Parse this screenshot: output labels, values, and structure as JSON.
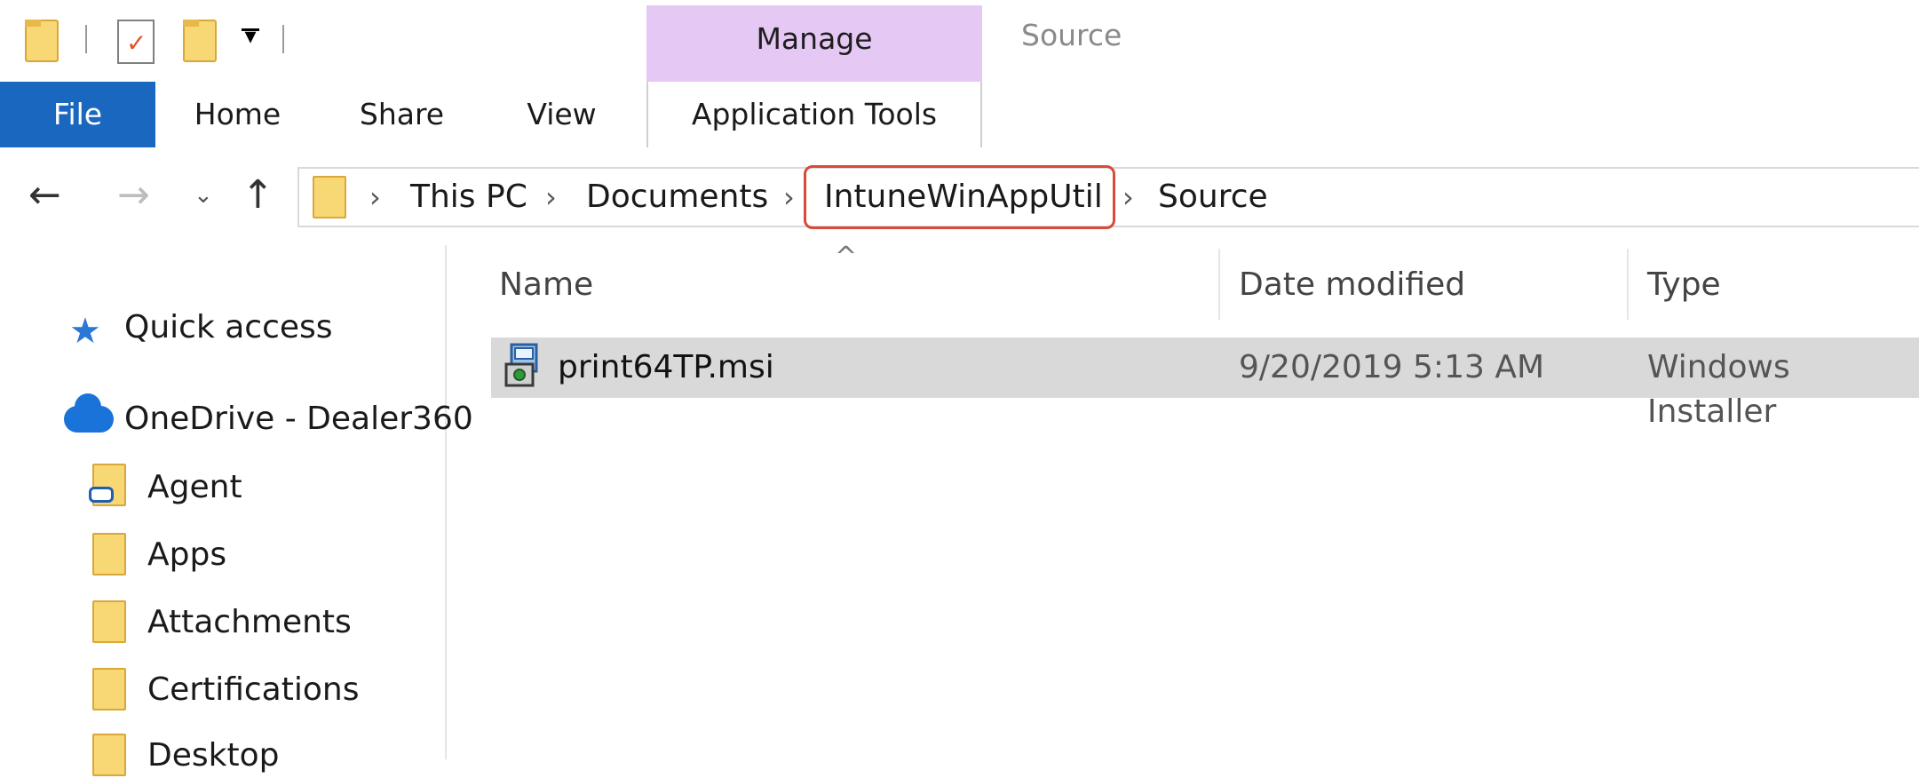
{
  "window": {
    "title": "Source"
  },
  "ribbon": {
    "context_group": "Manage",
    "tabs": [
      {
        "label": "File"
      },
      {
        "label": "Home"
      },
      {
        "label": "Share"
      },
      {
        "label": "View"
      },
      {
        "label": "Application Tools"
      }
    ]
  },
  "address": {
    "crumbs": [
      "This PC",
      "Documents",
      "IntuneWinAppUtil",
      "Source"
    ],
    "highlighted": "IntuneWinAppUtil"
  },
  "nav_pane": {
    "items": [
      {
        "label": "Quick access",
        "icon": "star-icon"
      },
      {
        "label": "OneDrive - Dealer360",
        "icon": "cloud-icon"
      },
      {
        "label": "Agent",
        "icon": "shared-folder-icon"
      },
      {
        "label": "Apps",
        "icon": "folder-icon"
      },
      {
        "label": "Attachments",
        "icon": "folder-icon"
      },
      {
        "label": "Certifications",
        "icon": "folder-icon"
      },
      {
        "label": "Desktop",
        "icon": "folder-icon"
      }
    ]
  },
  "file_list": {
    "columns": [
      "Name",
      "Date modified",
      "Type"
    ],
    "rows": [
      {
        "name": "print64TP.msi",
        "date": "9/20/2019 5:13 AM",
        "type": "Windows Installer",
        "selected": true
      }
    ]
  },
  "colors": {
    "file_tab": "#1a67c0",
    "context_group": "#e6c8f5",
    "highlight": "#d84a3a",
    "selection": "#d9d9d9"
  }
}
